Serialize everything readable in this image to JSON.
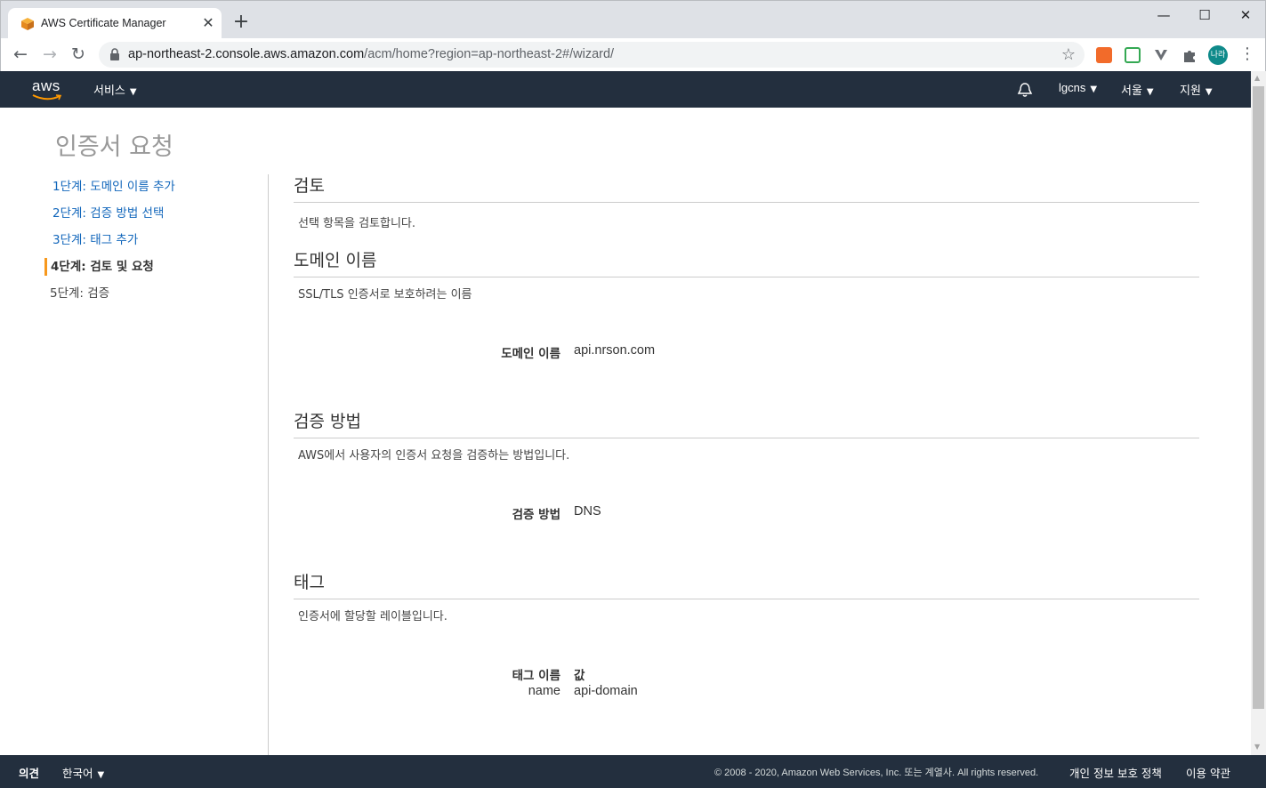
{
  "browser": {
    "tab_title": "AWS Certificate Manager",
    "tab_close": "✕",
    "new_tab": "+",
    "url_host": "ap-northeast-2.console.aws.amazon.com",
    "url_path": "/acm/home?region=ap-northeast-2#/wizard/",
    "profile_initials": "나라",
    "window_controls": {
      "minimize": "—",
      "maximize": "☐",
      "close": "✕"
    }
  },
  "aws_nav": {
    "logo": "aws",
    "services": "서비스",
    "account": "lgcns",
    "region": "서울",
    "support": "지원",
    "caret": "▼"
  },
  "page": {
    "title": "인증서 요청"
  },
  "steps": [
    {
      "label": "1단계: 도메인 이름 추가",
      "state": "link"
    },
    {
      "label": "2단계: 검증 방법 선택",
      "state": "link"
    },
    {
      "label": "3단계: 태그 추가",
      "state": "link"
    },
    {
      "label": "4단계: 검토 및 요청",
      "state": "current"
    },
    {
      "label": "5단계: 검증",
      "state": "future"
    }
  ],
  "review": {
    "heading": "검토",
    "description": "선택 항목을 검토합니다."
  },
  "domain": {
    "heading": "도메인 이름",
    "description": "SSL/TLS 인증서로 보호하려는 이름",
    "key": "도메인 이름",
    "value": "api.nrson.com"
  },
  "validation": {
    "heading": "검증 방법",
    "description": "AWS에서 사용자의 인증서 요청을 검증하는 방법입니다.",
    "key": "검증 방법",
    "value": "DNS"
  },
  "tags": {
    "heading": "태그",
    "description": "인증서에 할당할 레이블입니다.",
    "col_name": "태그 이름",
    "col_value": "값",
    "rows": [
      {
        "name": "name",
        "value": "api-domain"
      }
    ]
  },
  "footer": {
    "feedback": "의견",
    "language": "한국어",
    "copyright": "© 2008 - 2020, Amazon Web Services, Inc. 또는 계열사. All rights reserved.",
    "privacy": "개인 정보 보호 정책",
    "terms": "이용 약관"
  },
  "colors": {
    "aws_nav_bg": "#232f3e",
    "link": "#1166bb",
    "current_step_marker": "#f7981d"
  }
}
